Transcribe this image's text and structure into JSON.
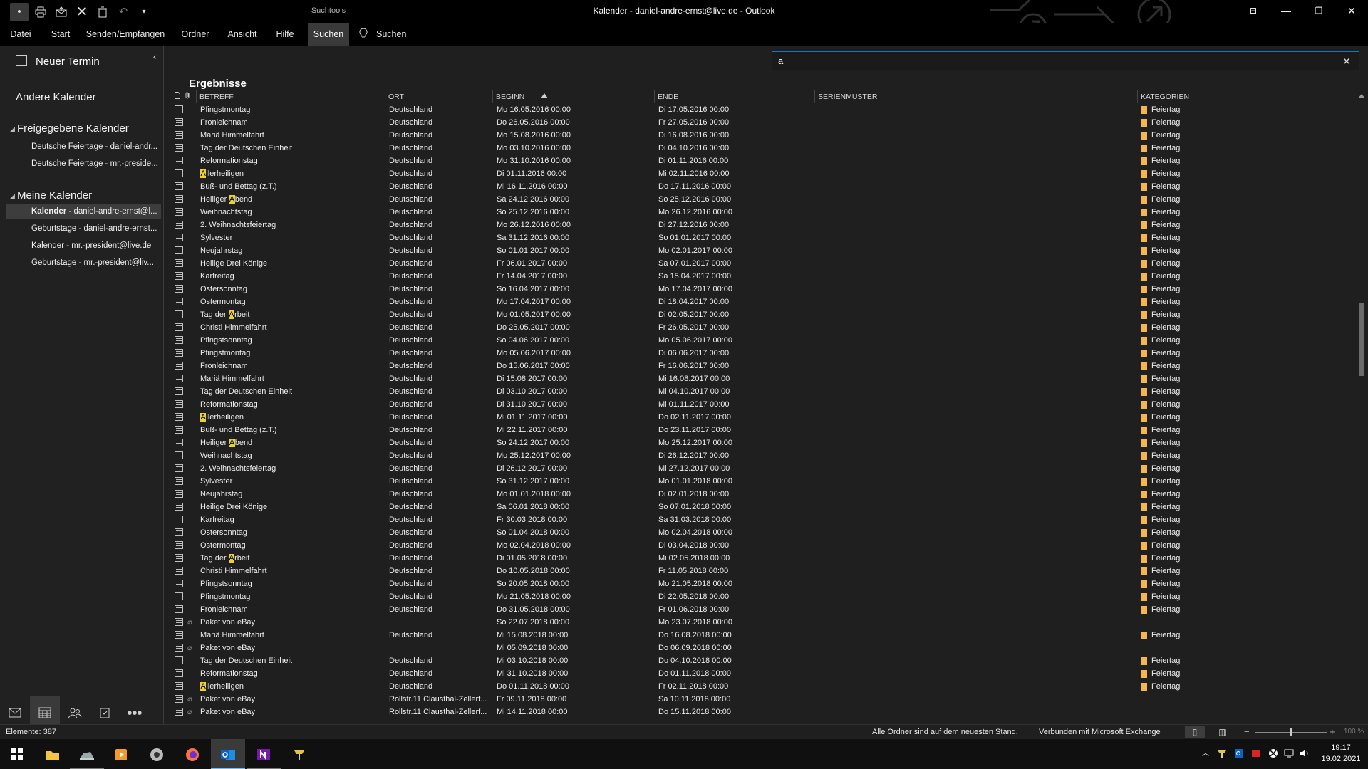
{
  "window": {
    "title": "Kalender - daniel-andre-ernst@live.de  -  Outlook",
    "contextual_tab": "Suchtools",
    "colors": {
      "accent": "#1c74c9",
      "category_feiertag": "#f5b550",
      "highlight": "#e8d13a"
    }
  },
  "quick_access": [
    "new-item-icon",
    "print-icon",
    "send-receive-icon",
    "delete-x-icon",
    "trash-icon",
    "undo-icon",
    "customize-icon"
  ],
  "ribbon": {
    "tabs": [
      "Datei",
      "Start",
      "Senden/Empfangen",
      "Ordner",
      "Ansicht",
      "Hilfe",
      "Suchen"
    ],
    "active": "Suchen",
    "tell_me": "Suchen"
  },
  "nav": {
    "new_appointment": "Neuer Termin",
    "other_calendars": "Andere Kalender",
    "shared_group": "Freigegebene Kalender",
    "shared_items": [
      "Deutsche Feiertage - daniel-andr...",
      "Deutsche Feiertage - mr.-preside..."
    ],
    "my_group": "Meine Kalender",
    "my_items": [
      {
        "name": "Kalender",
        "account": " - daniel-andre-ernst@l...",
        "selected": true
      },
      {
        "name": "Geburtstage",
        "account": " - daniel-andre-ernst...",
        "selected": false
      },
      {
        "name": "Kalender",
        "account": " - mr.-president@live.de",
        "selected": false
      },
      {
        "name": "Geburtstage",
        "account": " - mr.-president@liv...",
        "selected": false
      }
    ]
  },
  "search": {
    "value": "a",
    "placeholder": ""
  },
  "results": {
    "title": "Ergebnisse",
    "columns": {
      "subject": "BETREFF",
      "location": "ORT",
      "begin": "BEGINN",
      "end": "ENDE",
      "recurrence": "SERIENMUSTER",
      "categories": "KATEGORIEN"
    },
    "sorted_by": "BEGINN",
    "sort_direction": "ascending",
    "rows": [
      [
        "Pfingstmontag",
        "Deutschland",
        "Mo 16.05.2016 00:00",
        "Di 17.05.2016 00:00",
        "Feiertag"
      ],
      [
        "Fronleichnam",
        "Deutschland",
        "Do 26.05.2016 00:00",
        "Fr 27.05.2016 00:00",
        "Feiertag"
      ],
      [
        "Mariä Himmelfahrt",
        "Deutschland",
        "Mo 15.08.2016 00:00",
        "Di 16.08.2016 00:00",
        "Feiertag"
      ],
      [
        "Tag der Deutschen Einheit",
        "Deutschland",
        "Mo 03.10.2016 00:00",
        "Di 04.10.2016 00:00",
        "Feiertag"
      ],
      [
        "Reformationstag",
        "Deutschland",
        "Mo 31.10.2016 00:00",
        "Di 01.11.2016 00:00",
        "Feiertag"
      ],
      [
        "Allerheiligen",
        "Deutschland",
        "Di 01.11.2016 00:00",
        "Mi 02.11.2016 00:00",
        "Feiertag"
      ],
      [
        "Buß- und Bettag (z.T.)",
        "Deutschland",
        "Mi 16.11.2016 00:00",
        "Do 17.11.2016 00:00",
        "Feiertag"
      ],
      [
        "Heiliger Abend",
        "Deutschland",
        "Sa 24.12.2016 00:00",
        "So 25.12.2016 00:00",
        "Feiertag"
      ],
      [
        "Weihnachtstag",
        "Deutschland",
        "So 25.12.2016 00:00",
        "Mo 26.12.2016 00:00",
        "Feiertag"
      ],
      [
        "2. Weihnachtsfeiertag",
        "Deutschland",
        "Mo 26.12.2016 00:00",
        "Di 27.12.2016 00:00",
        "Feiertag"
      ],
      [
        "Sylvester",
        "Deutschland",
        "Sa 31.12.2016 00:00",
        "So 01.01.2017 00:00",
        "Feiertag"
      ],
      [
        "Neujahrstag",
        "Deutschland",
        "So 01.01.2017 00:00",
        "Mo 02.01.2017 00:00",
        "Feiertag"
      ],
      [
        "Heilige Drei Könige",
        "Deutschland",
        "Fr 06.01.2017 00:00",
        "Sa 07.01.2017 00:00",
        "Feiertag"
      ],
      [
        "Karfreitag",
        "Deutschland",
        "Fr 14.04.2017 00:00",
        "Sa 15.04.2017 00:00",
        "Feiertag"
      ],
      [
        "Ostersonntag",
        "Deutschland",
        "So 16.04.2017 00:00",
        "Mo 17.04.2017 00:00",
        "Feiertag"
      ],
      [
        "Ostermontag",
        "Deutschland",
        "Mo 17.04.2017 00:00",
        "Di 18.04.2017 00:00",
        "Feiertag"
      ],
      [
        "Tag der Arbeit",
        "Deutschland",
        "Mo 01.05.2017 00:00",
        "Di 02.05.2017 00:00",
        "Feiertag"
      ],
      [
        "Christi Himmelfahrt",
        "Deutschland",
        "Do 25.05.2017 00:00",
        "Fr 26.05.2017 00:00",
        "Feiertag"
      ],
      [
        "Pfingstsonntag",
        "Deutschland",
        "So 04.06.2017 00:00",
        "Mo 05.06.2017 00:00",
        "Feiertag"
      ],
      [
        "Pfingstmontag",
        "Deutschland",
        "Mo 05.06.2017 00:00",
        "Di 06.06.2017 00:00",
        "Feiertag"
      ],
      [
        "Fronleichnam",
        "Deutschland",
        "Do 15.06.2017 00:00",
        "Fr 16.06.2017 00:00",
        "Feiertag"
      ],
      [
        "Mariä Himmelfahrt",
        "Deutschland",
        "Di 15.08.2017 00:00",
        "Mi 16.08.2017 00:00",
        "Feiertag"
      ],
      [
        "Tag der Deutschen Einheit",
        "Deutschland",
        "Di 03.10.2017 00:00",
        "Mi 04.10.2017 00:00",
        "Feiertag"
      ],
      [
        "Reformationstag",
        "Deutschland",
        "Di 31.10.2017 00:00",
        "Mi 01.11.2017 00:00",
        "Feiertag"
      ],
      [
        "Allerheiligen",
        "Deutschland",
        "Mi 01.11.2017 00:00",
        "Do 02.11.2017 00:00",
        "Feiertag"
      ],
      [
        "Buß- und Bettag (z.T.)",
        "Deutschland",
        "Mi 22.11.2017 00:00",
        "Do 23.11.2017 00:00",
        "Feiertag"
      ],
      [
        "Heiliger Abend",
        "Deutschland",
        "So 24.12.2017 00:00",
        "Mo 25.12.2017 00:00",
        "Feiertag"
      ],
      [
        "Weihnachtstag",
        "Deutschland",
        "Mo 25.12.2017 00:00",
        "Di 26.12.2017 00:00",
        "Feiertag"
      ],
      [
        "2. Weihnachtsfeiertag",
        "Deutschland",
        "Di 26.12.2017 00:00",
        "Mi 27.12.2017 00:00",
        "Feiertag"
      ],
      [
        "Sylvester",
        "Deutschland",
        "So 31.12.2017 00:00",
        "Mo 01.01.2018 00:00",
        "Feiertag"
      ],
      [
        "Neujahrstag",
        "Deutschland",
        "Mo 01.01.2018 00:00",
        "Di 02.01.2018 00:00",
        "Feiertag"
      ],
      [
        "Heilige Drei Könige",
        "Deutschland",
        "Sa 06.01.2018 00:00",
        "So 07.01.2018 00:00",
        "Feiertag"
      ],
      [
        "Karfreitag",
        "Deutschland",
        "Fr 30.03.2018 00:00",
        "Sa 31.03.2018 00:00",
        "Feiertag"
      ],
      [
        "Ostersonntag",
        "Deutschland",
        "So 01.04.2018 00:00",
        "Mo 02.04.2018 00:00",
        "Feiertag"
      ],
      [
        "Ostermontag",
        "Deutschland",
        "Mo 02.04.2018 00:00",
        "Di 03.04.2018 00:00",
        "Feiertag"
      ],
      [
        "Tag der Arbeit",
        "Deutschland",
        "Di 01.05.2018 00:00",
        "Mi 02.05.2018 00:00",
        "Feiertag"
      ],
      [
        "Christi Himmelfahrt",
        "Deutschland",
        "Do 10.05.2018 00:00",
        "Fr 11.05.2018 00:00",
        "Feiertag"
      ],
      [
        "Pfingstsonntag",
        "Deutschland",
        "So 20.05.2018 00:00",
        "Mo 21.05.2018 00:00",
        "Feiertag"
      ],
      [
        "Pfingstmontag",
        "Deutschland",
        "Mo 21.05.2018 00:00",
        "Di 22.05.2018 00:00",
        "Feiertag"
      ],
      [
        "Fronleichnam",
        "Deutschland",
        "Do 31.05.2018 00:00",
        "Fr 01.06.2018 00:00",
        "Feiertag"
      ],
      [
        "Paket von eBay",
        "",
        "So 22.07.2018 00:00",
        "Mo 23.07.2018 00:00",
        ""
      ],
      [
        "Mariä Himmelfahrt",
        "Deutschland",
        "Mi 15.08.2018 00:00",
        "Do 16.08.2018 00:00",
        "Feiertag"
      ],
      [
        "Paket von eBay",
        "",
        "Mi 05.09.2018 00:00",
        "Do 06.09.2018 00:00",
        ""
      ],
      [
        "Tag der Deutschen Einheit",
        "Deutschland",
        "Mi 03.10.2018 00:00",
        "Do 04.10.2018 00:00",
        "Feiertag"
      ],
      [
        "Reformationstag",
        "Deutschland",
        "Mi 31.10.2018 00:00",
        "Do 01.11.2018 00:00",
        "Feiertag"
      ],
      [
        "Allerheiligen",
        "Deutschland",
        "Do 01.11.2018 00:00",
        "Fr 02.11.2018 00:00",
        "Feiertag"
      ],
      [
        "Paket von eBay",
        "Rollstr.11 Clausthal-Zellerf...",
        "Fr 09.11.2018 00:00",
        "Sa 10.11.2018 00:00",
        ""
      ],
      [
        "Paket von eBay",
        "Rollstr.11 Clausthal-Zellerf...",
        "Mi 14.11.2018 00:00",
        "Do 15.11.2018 00:00",
        ""
      ]
    ]
  },
  "status": {
    "items": "Elemente: 387",
    "sync": "Alle Ordner sind auf dem neuesten Stand.",
    "connection": "Verbunden mit Microsoft Exchange",
    "zoom": "100 %"
  },
  "taskbar": {
    "time": "19:17",
    "date": "19.02.2021",
    "apps": [
      "windows-start-icon",
      "file-explorer-icon",
      "app-icon",
      "media-player-icon",
      "browser-icon",
      "firefox-icon",
      "outlook-icon",
      "onenote-icon",
      "tool-icon"
    ]
  }
}
